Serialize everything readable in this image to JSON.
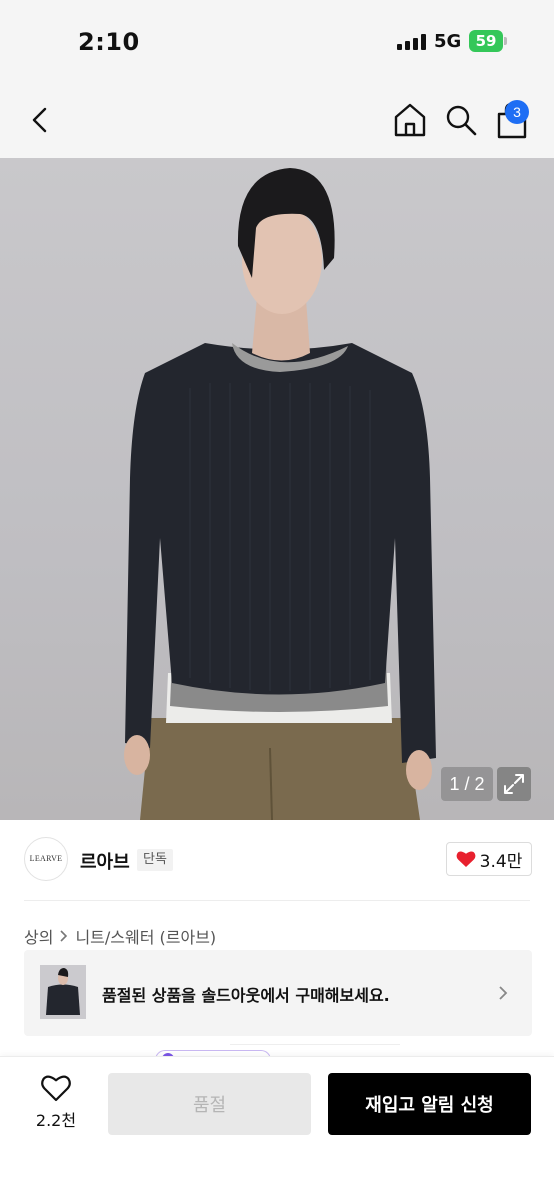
{
  "status_bar": {
    "time": "2:10",
    "network": "5G",
    "battery": "59"
  },
  "nav": {
    "cart_count": "3",
    "icons": [
      "back-icon",
      "home-icon",
      "search-icon",
      "bag-icon"
    ]
  },
  "gallery": {
    "counter": "1 / 2"
  },
  "brand": {
    "logo_text": "LEARVE",
    "name": "르아브",
    "tag": "단독",
    "likes": "3.4만",
    "like_color": "#e8202e"
  },
  "breadcrumb": {
    "category": "상의",
    "subcategory": "니트/스웨터 (르아브)"
  },
  "soldout_banner": {
    "text": "품절된 상품을 솔드아웃에서 구매해보세요."
  },
  "bottom_bar": {
    "wish_count": "2.2천",
    "soldout_label": "품절",
    "restock_label": "재입고 알림 신청"
  }
}
